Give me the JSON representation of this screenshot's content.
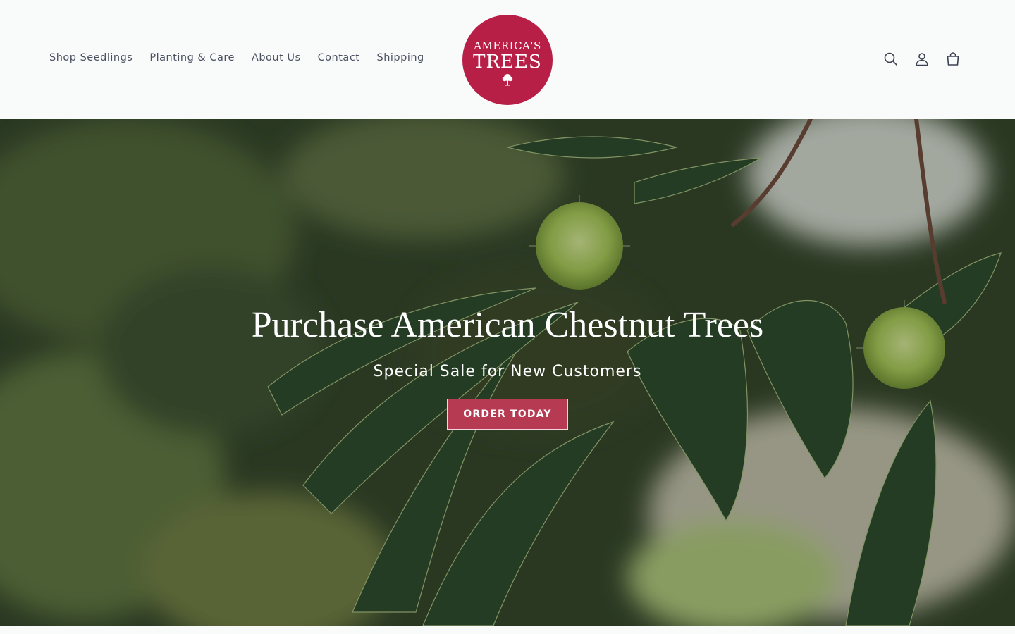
{
  "header": {
    "nav": [
      {
        "label": "Shop Seedlings"
      },
      {
        "label": "Planting & Care"
      },
      {
        "label": "About Us"
      },
      {
        "label": "Contact"
      },
      {
        "label": "Shipping"
      }
    ],
    "logo": {
      "line1": "AMERICA'S",
      "line2": "TREES",
      "color": "#b81f47"
    },
    "icons": [
      "search-icon",
      "account-icon",
      "cart-icon"
    ]
  },
  "hero": {
    "title": "Purchase American Chestnut Trees",
    "subtitle": "Special Sale for New Customers",
    "button_label": "ORDER TODAY",
    "button_color": "#b53a52"
  }
}
